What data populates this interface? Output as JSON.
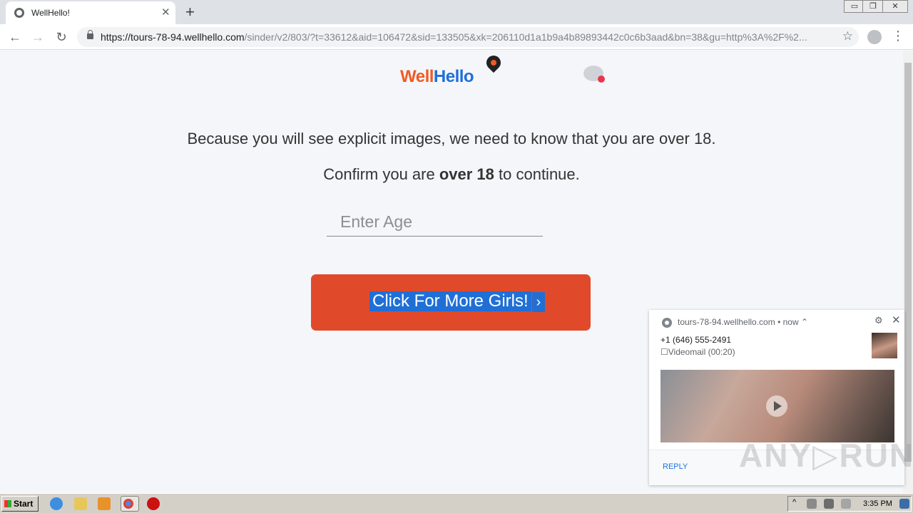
{
  "browser": {
    "tab_title": "WellHello!",
    "tab_close": "✕",
    "new_tab": "+",
    "url_host": "https://tours-78-94.wellhello.com",
    "url_path": "/sinder/v2/803/?t=33612&aid=106472&sid=133505&xk=206110d1a1b9a4b89893442c0c6b3aad&bn=38&gu=http%3A%2F%2...",
    "back": "←",
    "forward": "→",
    "reload": "↻",
    "star": "☆",
    "menu": "⋮",
    "window_buttons": [
      "▭",
      "❐",
      "✕"
    ]
  },
  "logo": {
    "well": "Well",
    "hello": "Hello"
  },
  "page": {
    "message1": "Because you will see explicit images, we need to know that you are over 18.",
    "message2_prefix": "Confirm you are ",
    "message2_bold": "over 18",
    "message2_suffix": " to continue.",
    "age_placeholder": "Enter Age",
    "age_value": "",
    "cta_label": "Click For More Girls!",
    "cta_arrow": "›"
  },
  "notification": {
    "header": "tours-78-94.wellhello.com • now ⌃",
    "gear": "⚙",
    "close": "✕",
    "title": "+1 (646) 555-2491",
    "body": "☐Videomail (00:20)",
    "reply": "REPLY"
  },
  "watermark": "ANY▷RUN",
  "taskbar": {
    "start": "Start",
    "clock": "3:35 PM"
  },
  "colors": {
    "accent_orange": "#e04a2b",
    "brand_blue": "#1e6fd9",
    "brand_orange": "#f15a24"
  }
}
